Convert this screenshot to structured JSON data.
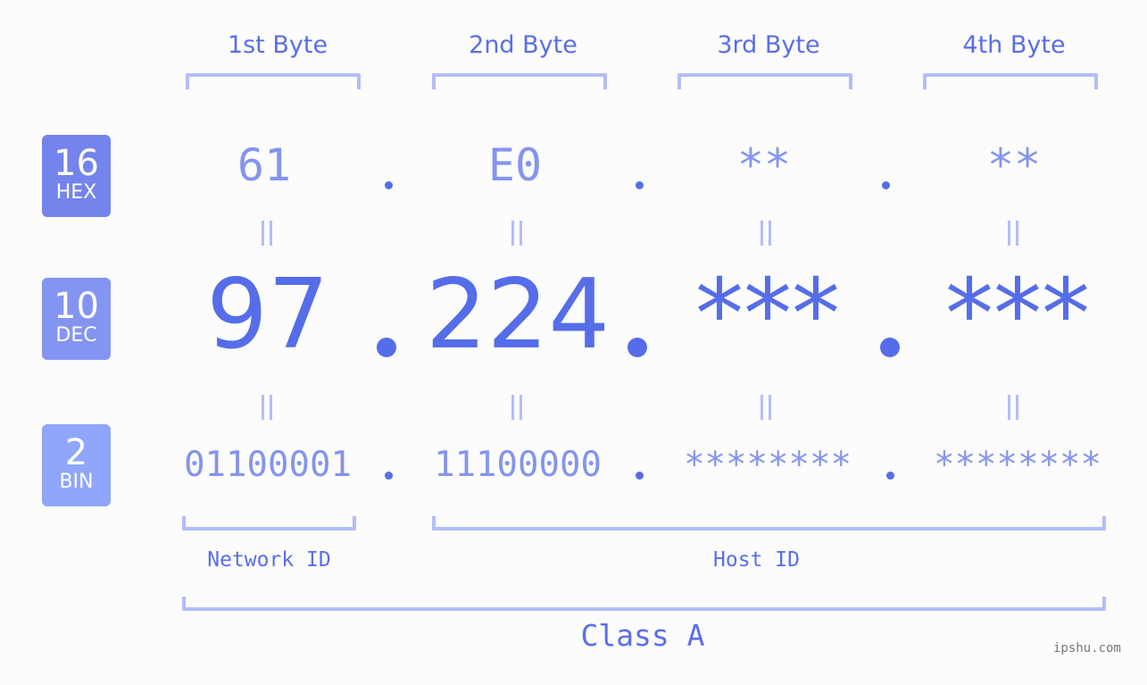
{
  "bytes": [
    {
      "label": "1st Byte",
      "hex": "61",
      "dec": "97",
      "bin": "01100001"
    },
    {
      "label": "2nd Byte",
      "hex": "E0",
      "dec": "224",
      "bin": "11100000"
    },
    {
      "label": "3rd Byte",
      "hex": "**",
      "dec": "***",
      "bin": "********"
    },
    {
      "label": "4th Byte",
      "hex": "**",
      "dec": "***",
      "bin": "********"
    }
  ],
  "badges": {
    "hex": {
      "num": "16",
      "sub": "HEX",
      "color": "#7484ec"
    },
    "dec": {
      "num": "10",
      "sub": "DEC",
      "color": "#8495f1"
    },
    "bin": {
      "num": "2",
      "sub": "BIN",
      "color": "#8fa6fa"
    }
  },
  "segments": {
    "network": "Network ID",
    "host": "Host ID"
  },
  "ip_class": "Class A",
  "watermark": "ipshu.com",
  "colors": {
    "accent": "#566de9",
    "muted": "#8494ee",
    "bracket": "#b3bdf7",
    "background": "#fbfcfb"
  }
}
